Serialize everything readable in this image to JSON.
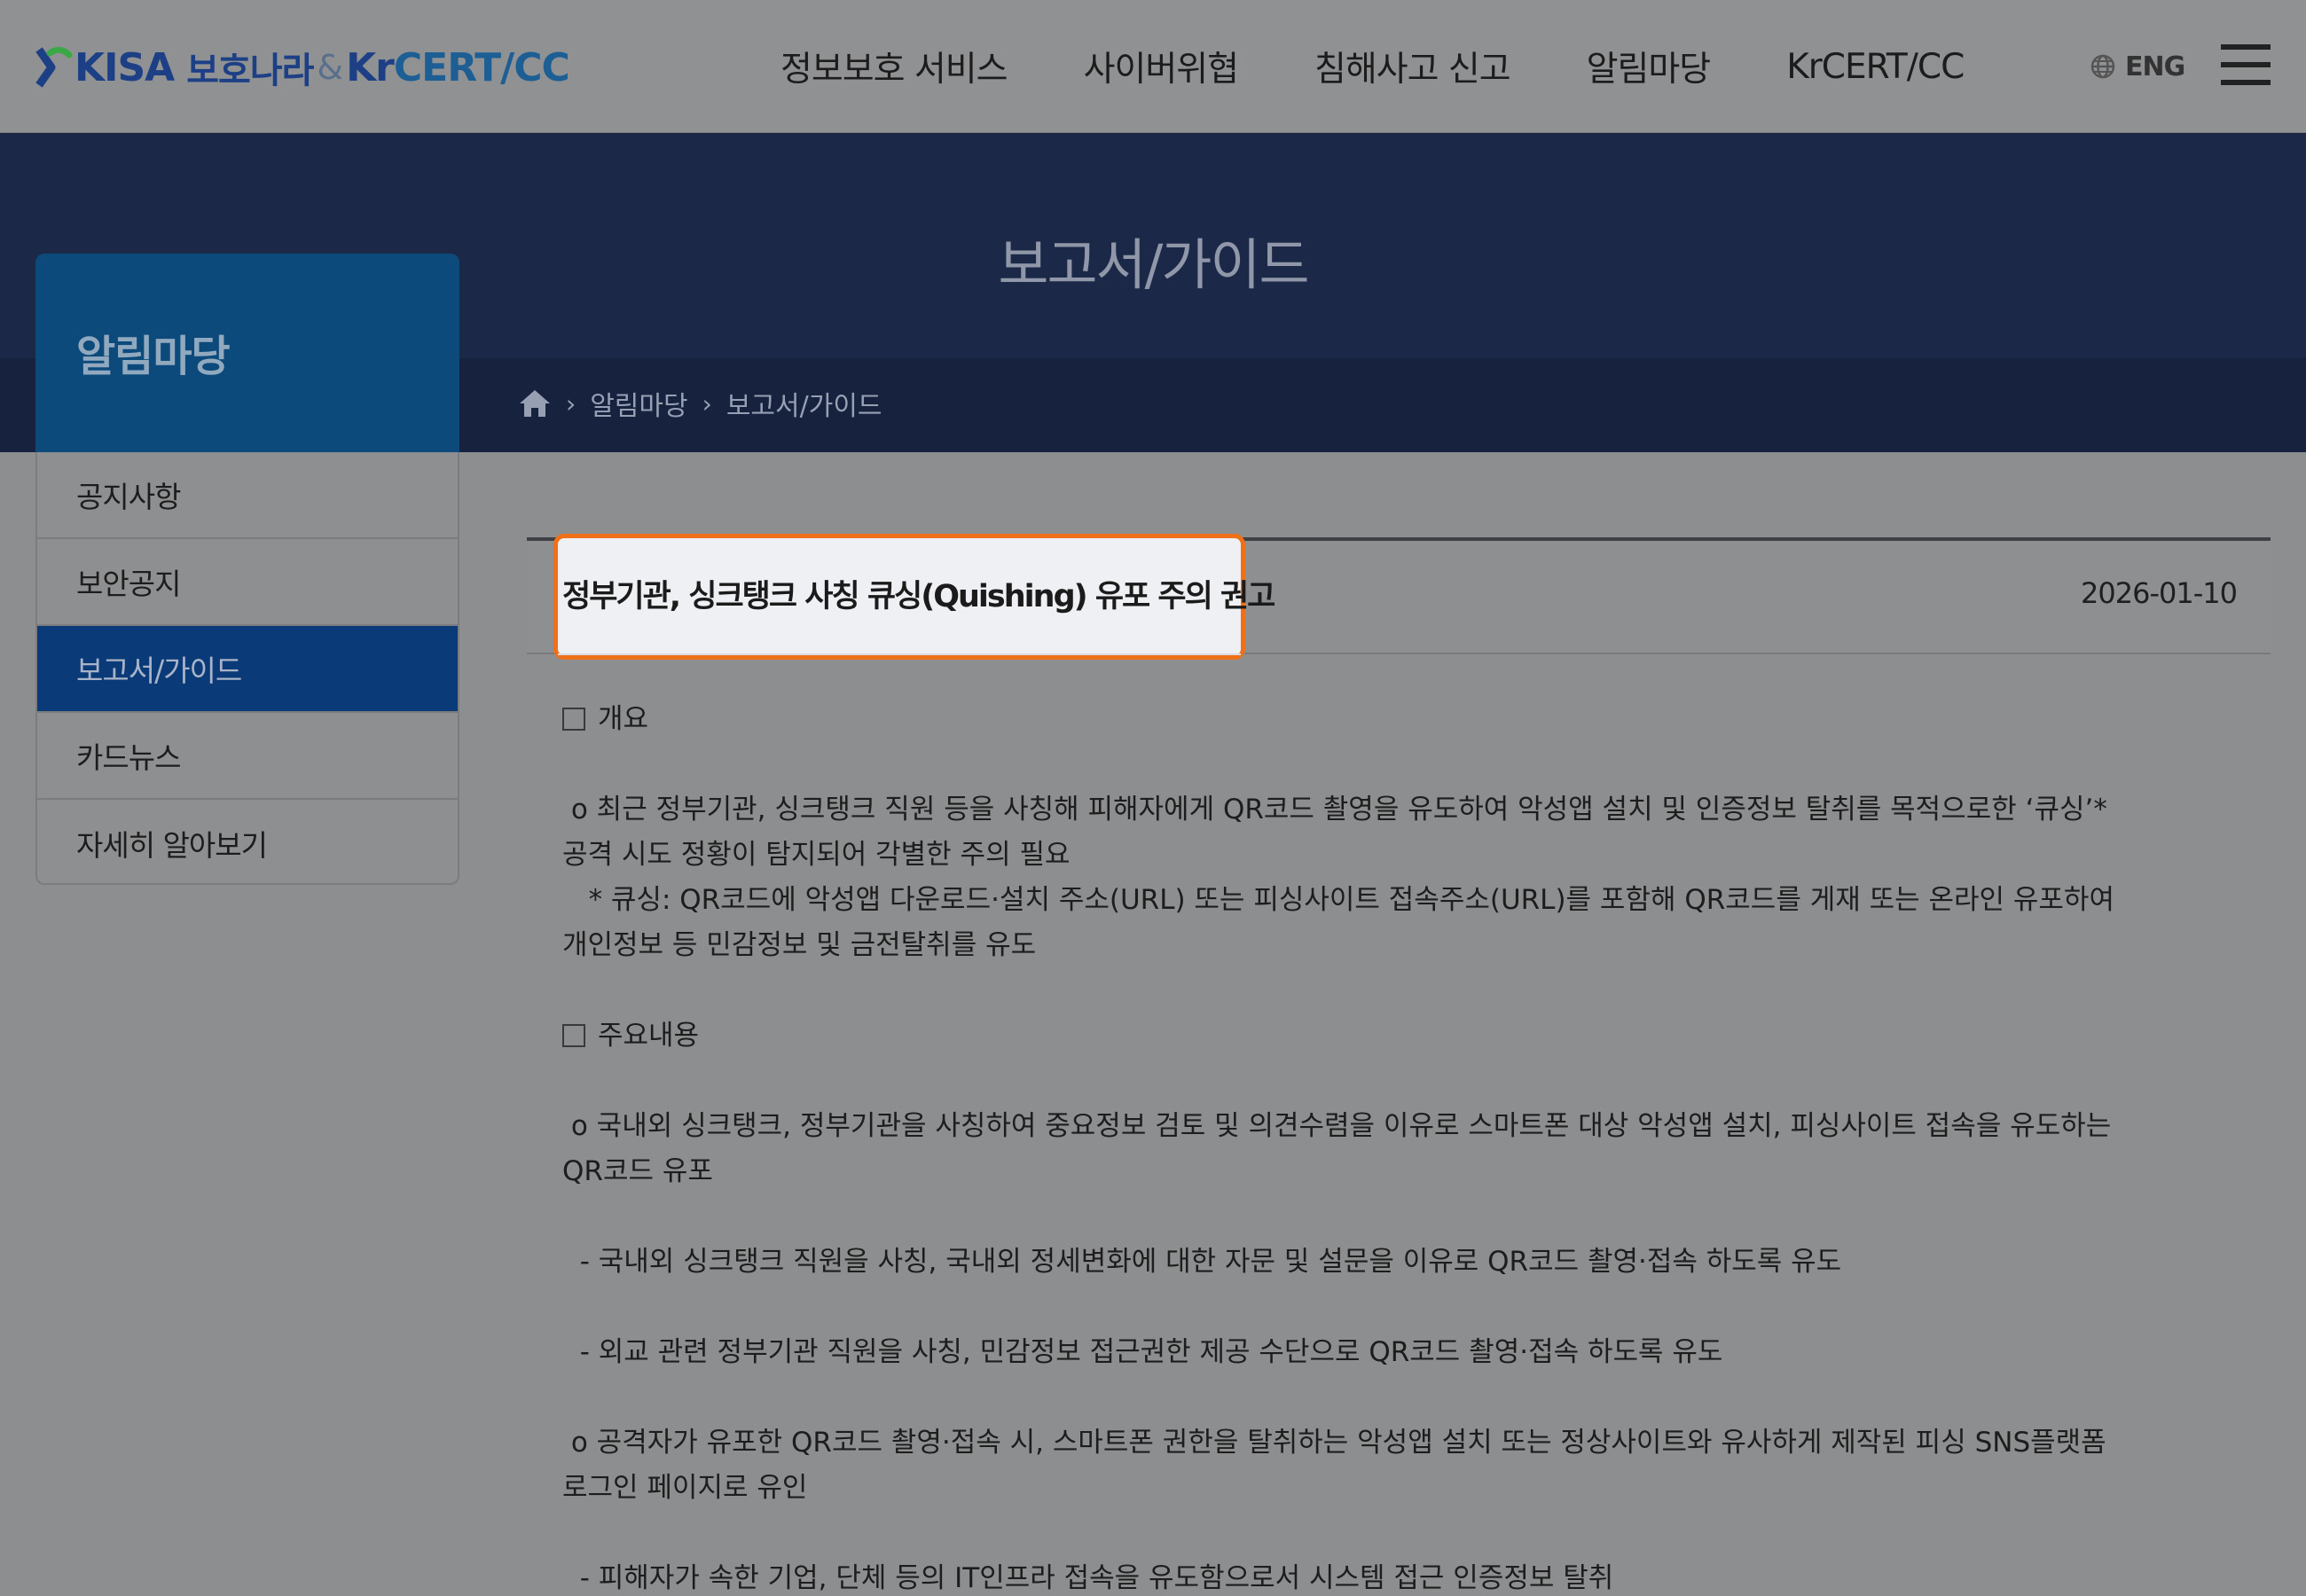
{
  "header": {
    "logo": {
      "kisa": "KISA",
      "bohonara": "보호나라",
      "amp": "&",
      "kr": "Kr",
      "cert": "CERT/CC"
    },
    "nav": [
      "정보보호 서비스",
      "사이버위협",
      "침해사고 신고",
      "알림마당",
      "KrCERT/CC"
    ],
    "lang_label": "ENG"
  },
  "banner": {
    "title": "보고서/가이드",
    "breadcrumb": [
      "알림마당",
      "보고서/가이드"
    ]
  },
  "sidebar": {
    "title": "알림마당",
    "items": [
      {
        "label": "공지사항",
        "active": false
      },
      {
        "label": "보안공지",
        "active": false
      },
      {
        "label": "보고서/가이드",
        "active": true
      },
      {
        "label": "카드뉴스",
        "active": false
      },
      {
        "label": "자세히 알아보기",
        "active": false
      }
    ]
  },
  "article": {
    "title": "정부기관, 싱크탱크 사칭 큐싱(Quishing) 유포 주의 권고",
    "date": "2026-01-10",
    "section1_heading": "개요",
    "section1_p1": " o 최근 정부기관, 싱크탱크 직원 등을 사칭해 피해자에게 QR코드 촬영을 유도하여 악성앱 설치 및 인증정보 탈취를 목적으로한 ‘큐싱’*\n공격 시도 정황이 탐지되어 각별한 주의 필요",
    "section1_p2": "   * 큐싱: QR코드에 악성앱 다운로드·설치 주소(URL) 또는 피싱사이트 접속주소(URL)를 포함해 QR코드를 게재 또는 온라인 유포하여\n개인정보 등 민감정보 및 금전탈취를 유도",
    "section2_heading": "주요내용",
    "section2_p1": " o 국내외 싱크탱크, 정부기관을 사칭하여 중요정보 검토 및 의견수렴을 이유로 스마트폰 대상 악성앱 설치, 피싱사이트 접속을 유도하는\nQR코드 유포",
    "section2_p2": "  - 국내외 싱크탱크 직원을 사칭, 국내외 정세변화에 대한 자문 및 설문을 이유로 QR코드 촬영·접속 하도록 유도",
    "section2_p3": "  - 외교 관련 정부기관 직원을 사칭, 민감정보 접근권한 제공 수단으로 QR코드 촬영·접속 하도록 유도",
    "section2_p4": " o 공격자가 유포한 QR코드 촬영·접속 시, 스마트폰 권한을 탈취하는 악성앱 설치 또는 정상사이트와 유사하게 제작된 피싱 SNS플랫폼\n로그인 페이지로 유인",
    "section2_p5": "  - 피해자가 속한 기업, 단체 등의 IT인프라 접속을 유도함으로서 시스템 접근 인증정보 탈취"
  },
  "colors": {
    "highlight_border": "#f07018",
    "active_sidebar": "#0b3a78",
    "banner": "#1b2847"
  }
}
